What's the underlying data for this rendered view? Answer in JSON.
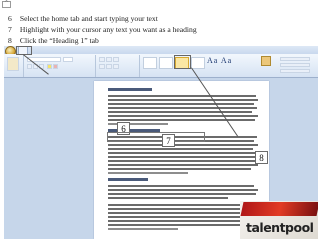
{
  "steps": [
    {
      "num": "6",
      "text": "Select the home tab and start typing your text"
    },
    {
      "num": "7",
      "text": "Highlight with your cursor any text you want as a heading"
    },
    {
      "num": "8",
      "text": "Click the “Heading 1” tab"
    }
  ],
  "callouts": {
    "home_tab": "6",
    "highlight": "7",
    "heading1": "8"
  },
  "brand": {
    "logo_text": "talentpool",
    "accent": "#c0201c"
  },
  "colors": {
    "ribbon": "#d6e3f3",
    "frame": "#c6d6ea",
    "page": "#ffffff"
  }
}
